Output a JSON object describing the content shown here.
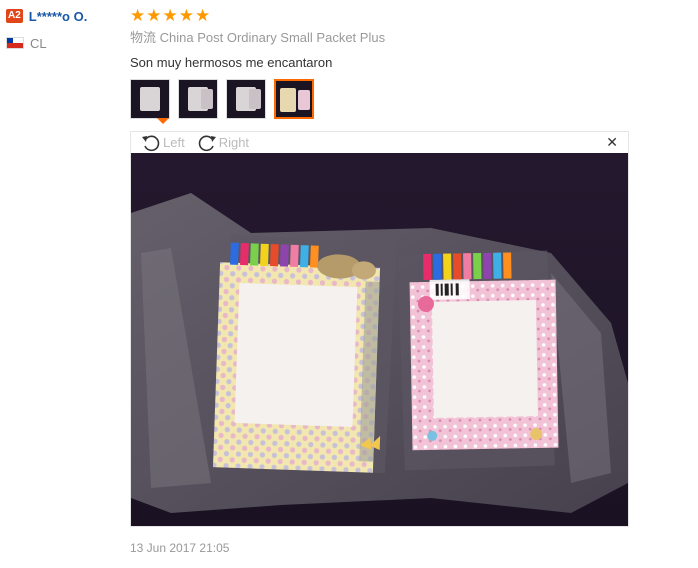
{
  "user": {
    "level_badge": "A2",
    "name": "L*****o O.",
    "country_code": "CL",
    "flag_icon": "chile-flag-icon"
  },
  "review": {
    "rating": 5,
    "rating_max": 5,
    "star_color": "#ff9900",
    "shipping_label": "物流",
    "shipping_method": "China Post Ordinary Small Packet Plus",
    "text": "Son muy hermosos me encantaron",
    "thumbnails_count": 4,
    "active_thumbnail": 4,
    "timestamp": "13 Jun 2017 21:05"
  },
  "viewer": {
    "rotate_left_label": "Left",
    "rotate_right_label": "Right",
    "close_icon": "close-icon",
    "accent_color": "#ff6a00"
  }
}
